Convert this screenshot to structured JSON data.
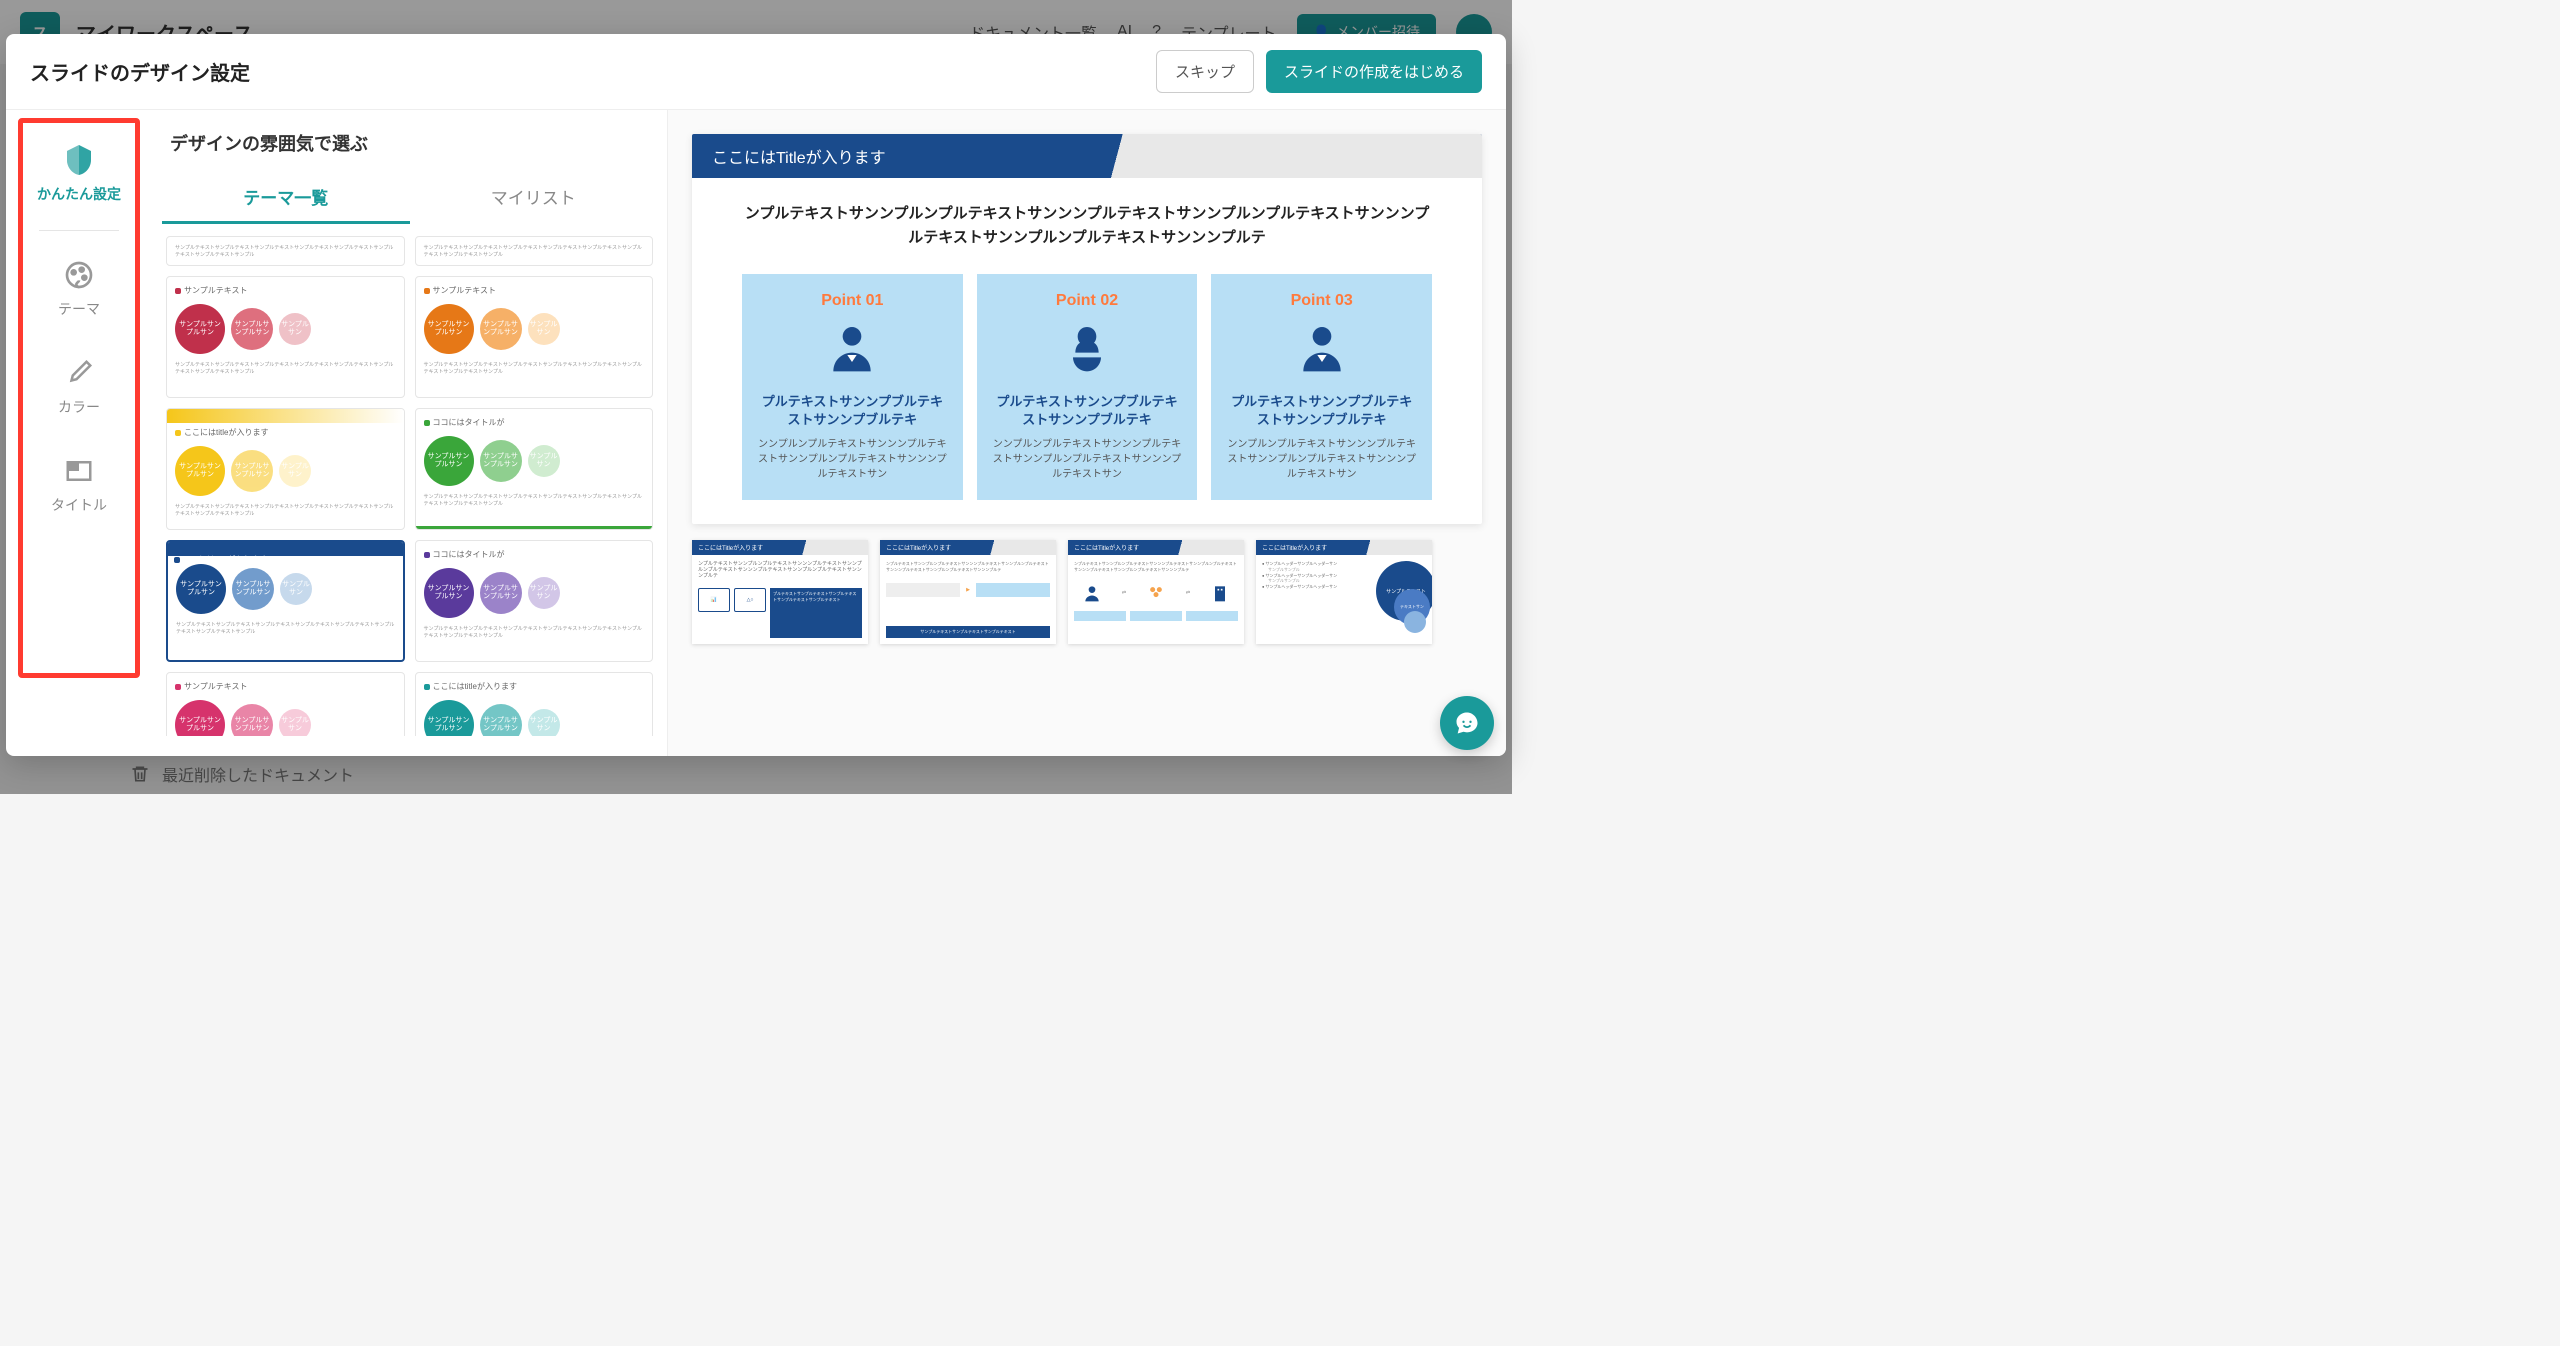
{
  "topbar": {
    "workspace": "マイワークスペース",
    "docs": "ドキュメント一覧",
    "ai": "AI",
    "templates": "テンプレート",
    "member": "メンバー招待"
  },
  "modal": {
    "title": "スライドのデザイン設定",
    "skip": "スキップ",
    "start": "スライドの作成をはじめる"
  },
  "sidebar": {
    "items": [
      {
        "label": "かんたん設定",
        "active": true
      },
      {
        "label": "テーマ"
      },
      {
        "label": "カラー"
      },
      {
        "label": "タイトル"
      }
    ]
  },
  "center": {
    "title": "デザインの雰囲気で選ぶ",
    "tabs": [
      "テーマ一覧",
      "マイリスト"
    ]
  },
  "themes": {
    "sample_label": "サンプルテキスト",
    "title_label": "ここにはtitleが入ります",
    "koko_title": "ココにはタイトルが",
    "circle_main": "サンプルサンプルサン",
    "circle_sub": "サンプルサンプルサン",
    "circle_small": "サンプルサン",
    "footer": "サンプルテキストサンプルテキストサンプルテキストサンプルテキストサンプルテキストサンプルテキストサンプルテキストサンプル"
  },
  "preview": {
    "title": "ここにはTitleが入ります",
    "subtitle": "ンプルテキストサンンプルンプルテキストサンンンプルテキストサンンプルンプルテキストサンンンプルテキストサンンプルンプルテキストサンンンプルテ",
    "points": [
      {
        "label": "Point 01",
        "title": "プルテキストサンンプブルテキストサンンプブルテキ",
        "desc": "ンンプルンプルテキストサンンンプルテキストサンンプルンプルテキストサンンンプルテキストサン"
      },
      {
        "label": "Point 02",
        "title": "プルテキストサンンプブルテキストサンンプブルテキ",
        "desc": "ンンプルンプルテキストサンンンプルテキストサンンプルンプルテキストサンンンプルテキストサン"
      },
      {
        "label": "Point 03",
        "title": "プルテキストサンンプブルテキストサンンプブルテキ",
        "desc": "ンンプルンプルテキストサンンンプルテキストサンンプルンプルテキストサンンンプルテキストサン"
      }
    ],
    "thumb_title": "ここにはTitleが入ります"
  },
  "footer": {
    "trash": "最近削除したドキュメント"
  }
}
